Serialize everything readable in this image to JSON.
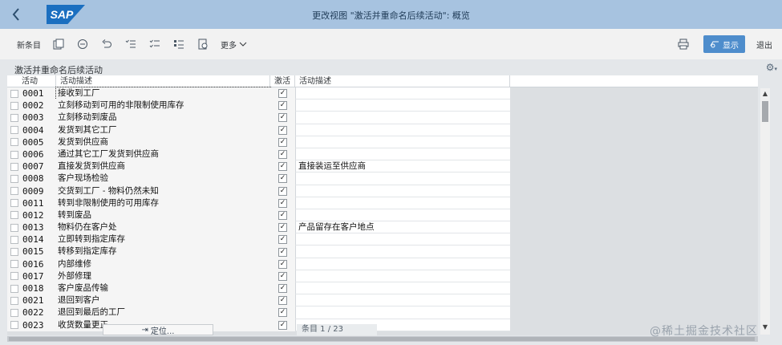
{
  "window": {
    "title": "更改视图 \"激活并重命名后续活动\": 概览",
    "logo_text": "SAP"
  },
  "toolbar": {
    "new_entries": "新条目",
    "more": "更多",
    "show": "显示",
    "exit": "退出",
    "icons": [
      "copy-icon",
      "delete-icon",
      "undo-icon",
      "select-all-icon",
      "deselect-all-icon",
      "select-block-icon",
      "bc-set-icon"
    ]
  },
  "section": {
    "title": "激活并重命名后续活动"
  },
  "table": {
    "columns": [
      "活动",
      "活动描述",
      "激活",
      "活动描述"
    ],
    "rows": [
      {
        "code": "0001",
        "desc": "接收到工厂",
        "active": true,
        "alt": ""
      },
      {
        "code": "0002",
        "desc": "立刻移动到可用的非限制使用库存",
        "active": true,
        "alt": ""
      },
      {
        "code": "0003",
        "desc": "立刻移动到废品",
        "active": true,
        "alt": ""
      },
      {
        "code": "0004",
        "desc": "发货到其它工厂",
        "active": true,
        "alt": ""
      },
      {
        "code": "0005",
        "desc": "发货到供应商",
        "active": true,
        "alt": ""
      },
      {
        "code": "0006",
        "desc": "通过其它工厂发货到供应商",
        "active": true,
        "alt": ""
      },
      {
        "code": "0007",
        "desc": "直接发货到供应商",
        "active": true,
        "alt": "直接装运至供应商"
      },
      {
        "code": "0008",
        "desc": "客户现场检验",
        "active": true,
        "alt": ""
      },
      {
        "code": "0009",
        "desc": "交货到工厂 - 物料仍然未知",
        "active": true,
        "alt": ""
      },
      {
        "code": "0011",
        "desc": "转到非限制使用的可用库存",
        "active": true,
        "alt": ""
      },
      {
        "code": "0012",
        "desc": "转到废品",
        "active": true,
        "alt": ""
      },
      {
        "code": "0013",
        "desc": "物料仍在客户处",
        "active": true,
        "alt": "产品留存在客户地点"
      },
      {
        "code": "0014",
        "desc": "立即转到指定库存",
        "active": true,
        "alt": ""
      },
      {
        "code": "0015",
        "desc": "转移到指定库存",
        "active": true,
        "alt": ""
      },
      {
        "code": "0016",
        "desc": "内部维修",
        "active": true,
        "alt": ""
      },
      {
        "code": "0017",
        "desc": "外部修理",
        "active": true,
        "alt": ""
      },
      {
        "code": "0018",
        "desc": "客户废品传输",
        "active": true,
        "alt": ""
      },
      {
        "code": "0021",
        "desc": "退回到客户",
        "active": true,
        "alt": ""
      },
      {
        "code": "0022",
        "desc": "退回到最后的工厂",
        "active": true,
        "alt": ""
      },
      {
        "code": "0023",
        "desc": "收货数量更正",
        "active": true,
        "alt": ""
      }
    ]
  },
  "footer": {
    "position_button": "定位...",
    "entry_info": "条目 1 / 23"
  },
  "watermark": "@稀土掘金技术社区",
  "colors": {
    "title_bar": "#a7c3e0",
    "show_button": "#4e8dcc",
    "sap_blue": "#1b6fc0"
  }
}
